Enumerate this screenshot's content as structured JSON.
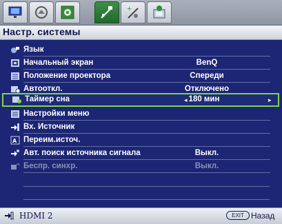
{
  "tabs": [
    {
      "name": "display-tab",
      "icon": "monitor-icon",
      "active": false
    },
    {
      "name": "picture-tab",
      "icon": "picture-icon",
      "active": false
    },
    {
      "name": "advanced-picture-tab",
      "icon": "gear-icon",
      "active": false
    },
    {
      "name": "system-setup-basic-tab",
      "icon": "settings-sliders-icon",
      "active": true
    },
    {
      "name": "system-setup-advanced-tab",
      "icon": "advanced-settings-icon",
      "active": false
    },
    {
      "name": "information-tab",
      "icon": "info-icon",
      "active": false
    }
  ],
  "header": {
    "title": "Настр. системы"
  },
  "menu": {
    "items": [
      {
        "label": "Язык",
        "value": "",
        "icon": "language-icon",
        "selected": false,
        "disabled": false
      },
      {
        "label": "Начальный экран",
        "value": "BenQ",
        "icon": "splash-screen-icon",
        "selected": false,
        "disabled": false
      },
      {
        "label": "Положение проектора",
        "value": "Спереди",
        "icon": "projector-position-icon",
        "selected": false,
        "disabled": false
      },
      {
        "label": "Автооткл.",
        "value": "Отключено",
        "icon": "auto-off-icon",
        "selected": false,
        "disabled": false
      },
      {
        "label": "Таймер сна",
        "value": "180 мин",
        "icon": "sleep-timer-icon",
        "selected": true,
        "disabled": false
      },
      {
        "label": "Настройки меню",
        "value": "",
        "icon": "menu-settings-icon",
        "selected": false,
        "disabled": false
      },
      {
        "label": "Вх. Источник",
        "value": "",
        "icon": "input-source-icon",
        "selected": false,
        "disabled": false
      },
      {
        "label": "Переим.источ.",
        "value": "",
        "icon": "rename-source-icon",
        "selected": false,
        "disabled": false
      },
      {
        "label": "Авт. поиск источника сигнала",
        "value": "Выкл.",
        "icon": "auto-search-icon",
        "selected": false,
        "disabled": false
      },
      {
        "label": "Беспр. синхр.",
        "value": "Выкл.",
        "icon": "wireless-sync-icon",
        "selected": false,
        "disabled": true
      }
    ]
  },
  "footer": {
    "source_icon": "input-source-icon",
    "source": "HDMI 2",
    "exit_label": "EXIT",
    "back_label": "Назад"
  },
  "colors": {
    "background": "#1c2674",
    "selection_border": "#7fd84a",
    "active_tab": "#2f7d3a"
  }
}
